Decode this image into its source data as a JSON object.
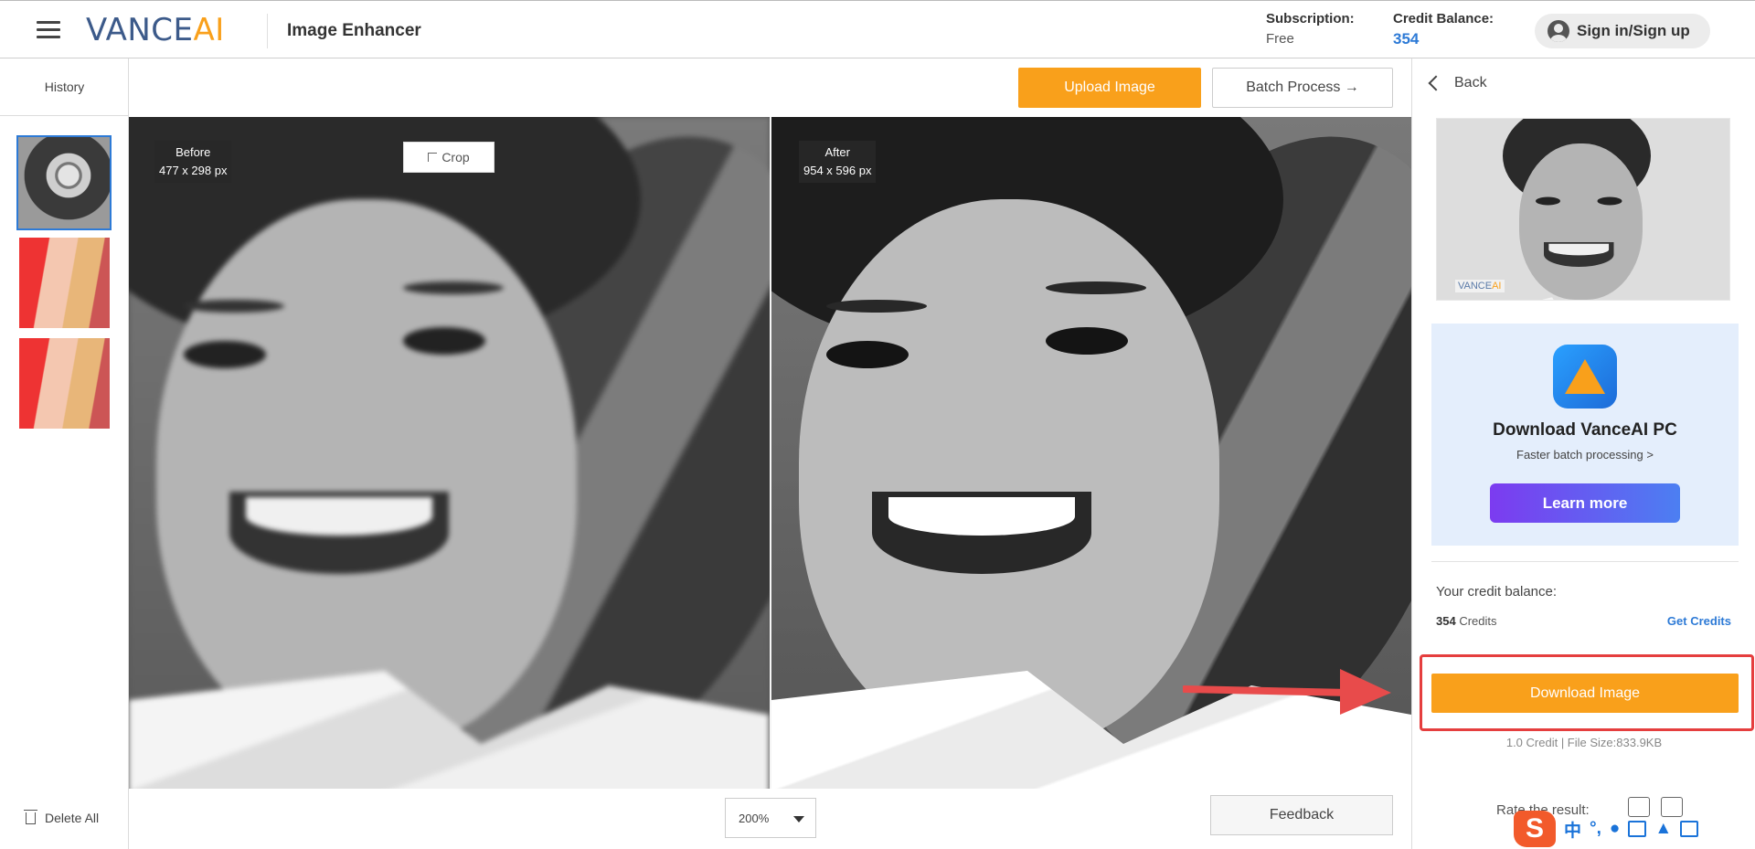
{
  "header": {
    "logo_main": "VANCE",
    "logo_ai": "AI",
    "app_name": "Image Enhancer",
    "subscription_label": "Subscription:",
    "subscription_value": "Free",
    "credit_label": "Credit Balance:",
    "credit_value": "354",
    "signin_label": "Sign in/Sign up"
  },
  "sidebar": {
    "history_label": "History",
    "delete_all_label": "Delete All"
  },
  "toolbar": {
    "upload_label": "Upload Image",
    "batch_label": "Batch Process →"
  },
  "compare": {
    "before_label": "Before",
    "before_size": "477 x 298 px",
    "after_label": "After",
    "after_size": "954 x 596 px",
    "crop_label": "Crop"
  },
  "bottom": {
    "zoom_value": "200%",
    "feedback_label": "Feedback"
  },
  "right_panel": {
    "back_label": "Back",
    "watermark_main": "VANCE",
    "watermark_ai": "AI",
    "promo_title": "Download VanceAI PC",
    "promo_sub": "Faster batch processing >",
    "learn_more_label": "Learn more",
    "credit_balance_label": "Your credit balance:",
    "credits_number": "354",
    "credits_unit": "Credits",
    "get_credits_label": "Get Credits",
    "download_label": "Download Image",
    "file_info": "1.0 Credit | File Size:833.9KB",
    "rate_label": "Rate the result:"
  },
  "ime": {
    "logo": "S",
    "chinese": "中",
    "punct": "°,"
  },
  "colors": {
    "accent_orange": "#f9a01b",
    "link_blue": "#2d7ad6",
    "highlight_red": "#e53e3e"
  }
}
